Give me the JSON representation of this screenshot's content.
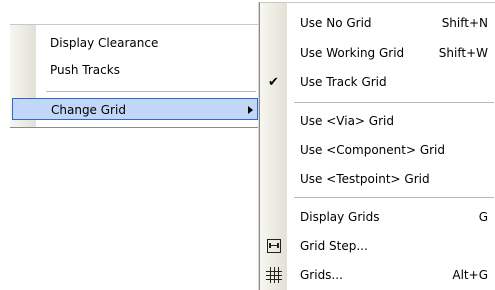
{
  "context_menu": {
    "items": [
      {
        "label": "Display Clearance"
      },
      {
        "label": "Push Tracks"
      },
      {
        "label": "Change Grid",
        "highlighted": true,
        "has_submenu": true
      }
    ]
  },
  "grid_submenu": {
    "items": [
      {
        "label": "Use No Grid",
        "shortcut": "Shift+N"
      },
      {
        "label": "Use Working Grid",
        "shortcut": "Shift+W"
      },
      {
        "label": "Use Track Grid",
        "checked": true
      },
      {
        "label": "Use <Via> Grid"
      },
      {
        "label": "Use <Component> Grid"
      },
      {
        "label": "Use <Testpoint> Grid"
      },
      {
        "label": "Display Grids",
        "shortcut": "G"
      },
      {
        "label": "Grid Step...",
        "icon": "grid-step-icon"
      },
      {
        "label": "Grids...",
        "shortcut": "Alt+G",
        "icon": "grids-icon"
      }
    ]
  }
}
